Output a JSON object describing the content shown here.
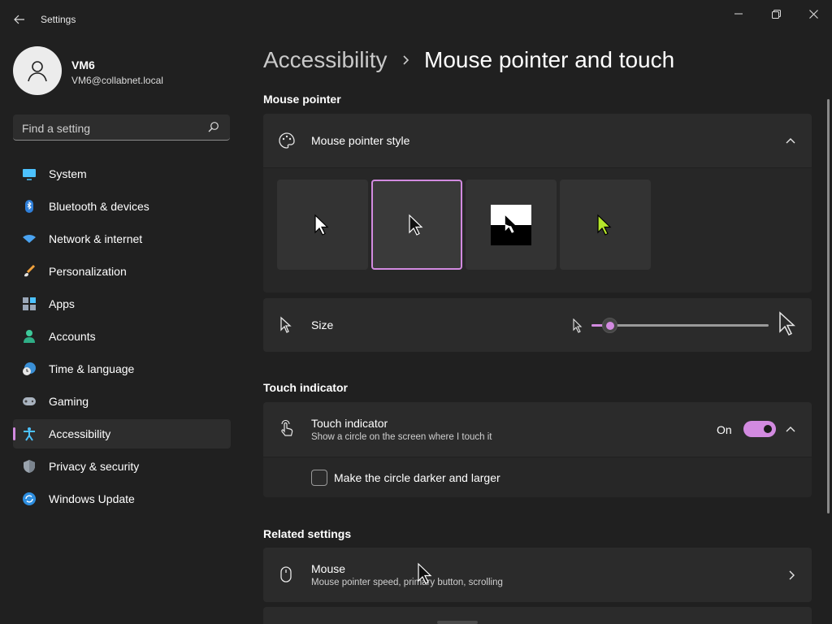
{
  "window": {
    "title": "Settings"
  },
  "user": {
    "name": "VM6",
    "email": "VM6@collabnet.local"
  },
  "search": {
    "placeholder": "Find a setting"
  },
  "sidebar": {
    "items": [
      {
        "label": "System",
        "icon": "monitor-icon",
        "active": false
      },
      {
        "label": "Bluetooth & devices",
        "icon": "bluetooth-icon",
        "active": false
      },
      {
        "label": "Network & internet",
        "icon": "wifi-icon",
        "active": false
      },
      {
        "label": "Personalization",
        "icon": "brush-icon",
        "active": false
      },
      {
        "label": "Apps",
        "icon": "apps-icon",
        "active": false
      },
      {
        "label": "Accounts",
        "icon": "person-icon",
        "active": false
      },
      {
        "label": "Time & language",
        "icon": "globe-clock-icon",
        "active": false
      },
      {
        "label": "Gaming",
        "icon": "gamepad-icon",
        "active": false
      },
      {
        "label": "Accessibility",
        "icon": "accessibility-icon",
        "active": true
      },
      {
        "label": "Privacy & security",
        "icon": "shield-icon",
        "active": false
      },
      {
        "label": "Windows Update",
        "icon": "update-icon",
        "active": false
      }
    ]
  },
  "breadcrumb": {
    "parent": "Accessibility",
    "current": "Mouse pointer and touch"
  },
  "mouse_pointer": {
    "section_title": "Mouse pointer",
    "style": {
      "label": "Mouse pointer style",
      "options": [
        "White",
        "Black",
        "Inverted",
        "Custom"
      ],
      "selected_index": 1
    },
    "size": {
      "label": "Size",
      "value_fraction": 0.1
    }
  },
  "touch_indicator": {
    "section_title": "Touch indicator",
    "title": "Touch indicator",
    "description": "Show a circle on the screen where I touch it",
    "state_label": "On",
    "checkbox_label": "Make the circle darker and larger",
    "checked": false
  },
  "related": {
    "section_title": "Related settings",
    "mouse": {
      "title": "Mouse",
      "description": "Mouse pointer speed, primary button, scrolling"
    }
  },
  "colors": {
    "accent": "#d28ae0",
    "background": "#202020",
    "card": "#2b2b2b"
  }
}
